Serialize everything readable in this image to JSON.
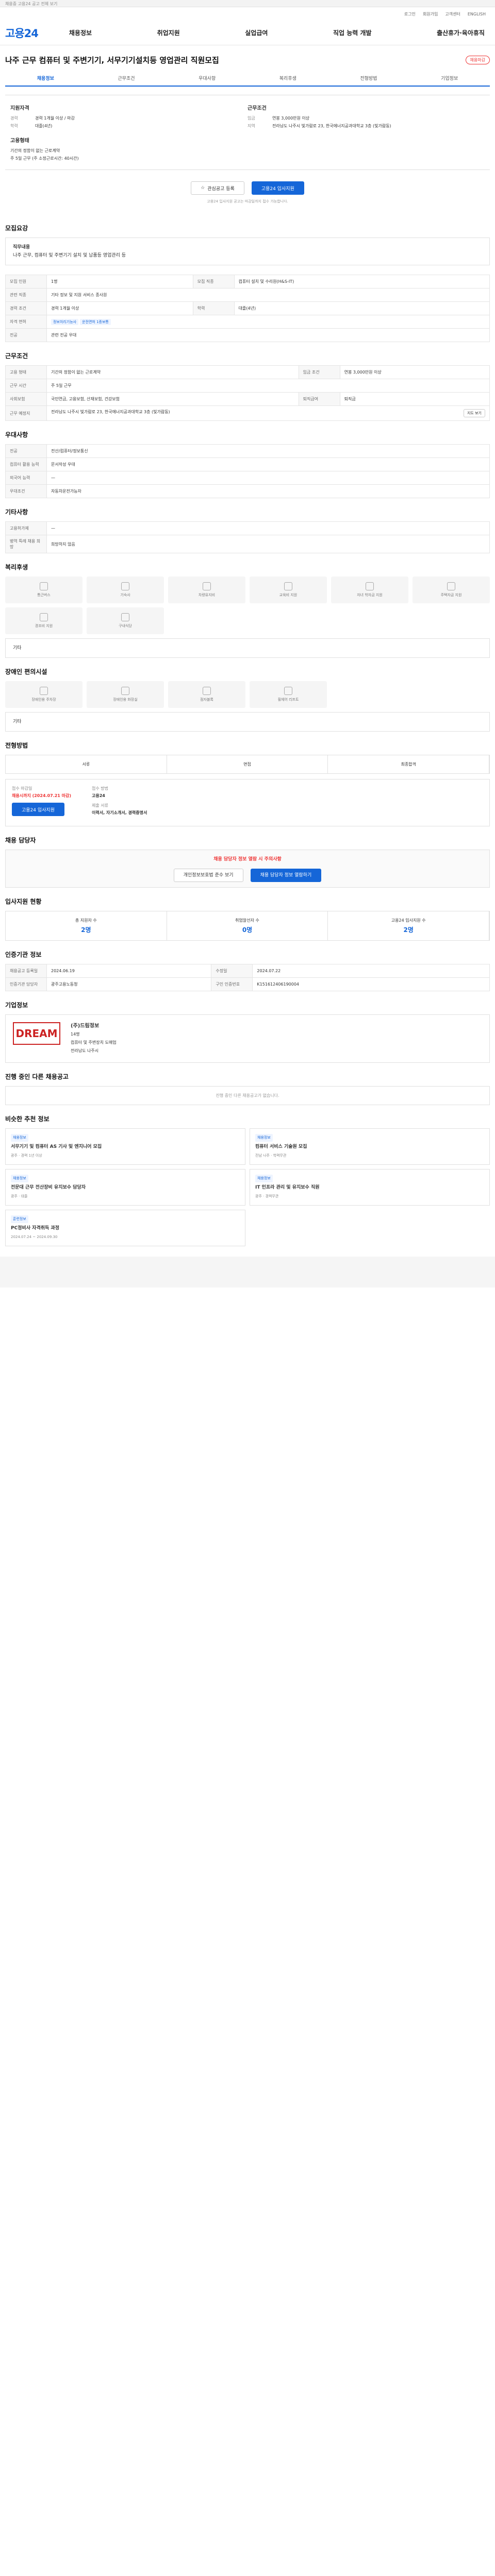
{
  "top_notice": "채용중 고용24 공고 전체 보기",
  "util": [
    "로그인",
    "회원가입",
    "고객센터",
    "ENGLISH"
  ],
  "logo": "고용24",
  "gnb": [
    "채용정보",
    "취업지원",
    "실업급여",
    "직업 능력 개발",
    "출산휴가·육아휴직"
  ],
  "title": "나주 근무 컴퓨터 및 주변기기, 서무기기설치등 영업관리 직원모집",
  "status": "채용마감",
  "tabs": [
    "채용정보",
    "근무조건",
    "우대사항",
    "복리후생",
    "전형방법",
    "기업정보"
  ],
  "summary": {
    "left_title": "지원자격",
    "exp_k": "경력",
    "exp_v": "경력 1개월 이상 / 마감",
    "edu_k": "학력",
    "edu_v": "대졸(4년)",
    "cond_title": "근무조건",
    "pay_k": "임금",
    "pay_v": "연봉 3,000만원 이상",
    "loc_k": "지역",
    "loc_v": "전라남도 나주시 빛가람로 23, 한국에너지공과대학교 3층 (빛가람동)",
    "type_title": "고용형태",
    "type_v": "기간의 정함이 없는 근로계약",
    "hours_v": "주 5일 근무 (주 소정근로시간: 40시간)"
  },
  "btn_save": "관심공고 등록",
  "btn_apply": "고용24 입사지원",
  "note": "고용24 입사지원 공고는 마감일까지 접수 가능합니다.",
  "detail": {
    "title": "모집요강",
    "job_h": "직무내용",
    "job": "나주 근무, 컴퓨터 및 주변기기 설치 및 납품등 영업관리 등"
  },
  "req": {
    "h1": "모집 인원",
    "v1": "1명",
    "h2": "모집 직종",
    "v2": "컴퓨터 설치 및 수리원(H&S-IT)",
    "h3": "관련 직종",
    "v3": "기타 정보 및 지원 서비스 종사원",
    "h4": "경력 조건",
    "v4": "경력 1개월 이상",
    "h5": "학력",
    "v5": "대졸(4년)",
    "h6": "자격 면허",
    "v6": "정보처리기능사",
    "v6b": "운전면허 1종보통",
    "h7": "전공",
    "v7": "관련 전공 우대"
  },
  "cond": {
    "title": "근무조건",
    "h1": "고용 형태",
    "v1": "기간의 정함이 없는 근로계약",
    "h2": "임금 조건",
    "v2": "연봉 3,000만원 이상",
    "h3": "근무 시간",
    "v3": "주 5일 근무",
    "h4": "사회보험",
    "v4": "국민연금, 고용보험, 산재보험, 건강보험",
    "h5": "퇴직급여",
    "v5": "퇴직금",
    "h6": "근무 예정지",
    "v6": "전라남도 나주시 빛가람로 23, 한국에너지공과대학교 3층 (빛가람동)",
    "map": "지도 보기"
  },
  "pref": {
    "title": "우대사항",
    "h1": "전공",
    "v1": "전산/컴퓨터/정보통신",
    "h2": "컴퓨터 활용 능력",
    "v2": "문서작성 우대",
    "h3": "외국어 능력",
    "v3": "—",
    "h4": "우대조건",
    "v4": "자동차운전가능자"
  },
  "other": {
    "title": "기타사항",
    "h1": "고용허가제",
    "v1": "—",
    "h2": "병역 특례 채용 희망",
    "v2": "희망하지 않음"
  },
  "welfare": {
    "title": "복리후생",
    "items": [
      "통근버스",
      "기숙사",
      "차량유지비",
      "교육비 지원",
      "자녀 학자금 지원",
      "주택자금 지원",
      "경조비 지원",
      "구내식당",
      "기타"
    ]
  },
  "etc": {
    "title": "장애인 편의시설",
    "items": [
      "장애인용 주차장",
      "장애인용 화장실",
      "점자블록",
      "휠체어 리프트",
      "기타"
    ]
  },
  "process": {
    "title": "전형방법",
    "steps": [
      "서류",
      "면접",
      "최종합격"
    ],
    "k1": "접수 마감일",
    "v1": "채용시까지 (2024.07.21 마감)",
    "k2": "접수 방법",
    "v2": "고용24",
    "k3": "제출 서류",
    "v3": "이력서, 자기소개서, 경력증명서",
    "btn": "고용24 입사지원"
  },
  "contact": {
    "title": "채용 담당자",
    "warn": "채용 담당자 정보 열람 시 주의사항",
    "btn1": "개인정보보호법 준수 보기",
    "btn2": "채용 담당자 정보 열람하기"
  },
  "stats": {
    "title": "입사지원 현황",
    "s1": "총 지원자 수",
    "v1": "2명",
    "s2": "취업알선자 수",
    "v2": "0명",
    "s3": "고용24 입사지원 수",
    "v3": "2명"
  },
  "info": {
    "title": "인증기관 정보",
    "h1": "채용공고 등록일",
    "v1": "2024.06.19",
    "h2": "수정일",
    "v2": "2024.07.22",
    "h3": "인증기관 담당자",
    "v3": "광주고용노동청",
    "h4": "구인 인증번호",
    "v4": "K151612406190004"
  },
  "company": {
    "title": "기업정보",
    "logo": "DREAM",
    "name": "(주)드림정보",
    "emp": "14명",
    "industry": "컴퓨터 및 주변장치 도매업",
    "addr": "전라남도 나주시"
  },
  "other_jobs": {
    "title": "진행 중인 다른 채용공고",
    "empty": "진행 중인 다른 채용공고가 없습니다."
  },
  "similar": {
    "title": "비슷한 추천 정보",
    "cards": [
      {
        "tag": "채용정보",
        "t": "서무기기 및 컴퓨터 AS 기사 및 엔지니어 모집",
        "d": "광주 · 경력 1년 이상"
      },
      {
        "tag": "채용정보",
        "t": "컴퓨터 서비스 기술원 모집",
        "d": "전남 나주 · 학력무관"
      },
      {
        "tag": "채용정보",
        "t": "전문대 근무 전산장비 유지보수 담당자",
        "d": "광주 · 대졸"
      },
      {
        "tag": "채용정보",
        "t": "IT 인프라 관리 및 유지보수 직원",
        "d": "광주 · 경력무관"
      },
      {
        "tag": "훈련정보",
        "t": "PC정비사 자격취득 과정",
        "d": "2024.07.24 ~ 2024.09.30"
      }
    ]
  }
}
